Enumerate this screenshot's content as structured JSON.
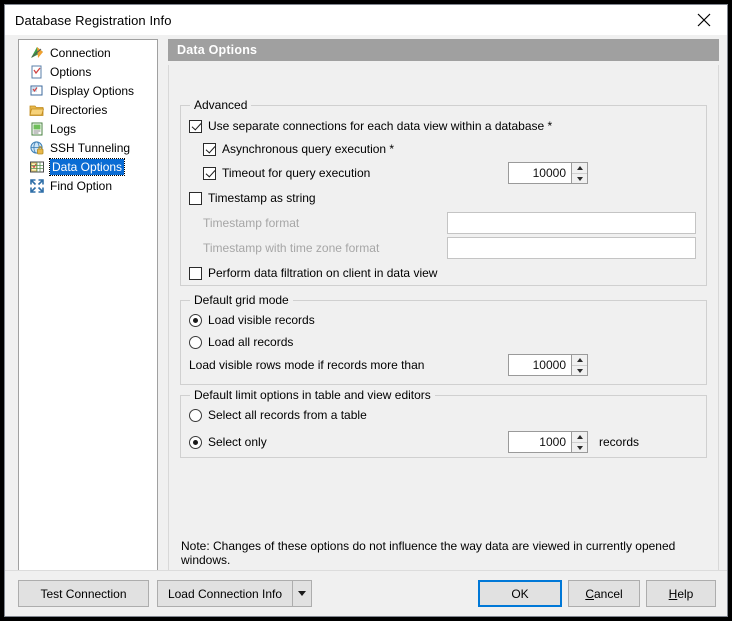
{
  "window": {
    "title": "Database Registration Info",
    "close_icon": "close-icon"
  },
  "sidebar": {
    "items": [
      {
        "label": "Connection",
        "icon": "connection-icon",
        "selected": false
      },
      {
        "label": "Options",
        "icon": "options-icon",
        "selected": false
      },
      {
        "label": "Display Options",
        "icon": "display-options-icon",
        "selected": false
      },
      {
        "label": "Directories",
        "icon": "directories-icon",
        "selected": false
      },
      {
        "label": "Logs",
        "icon": "logs-icon",
        "selected": false
      },
      {
        "label": "SSH Tunneling",
        "icon": "ssh-tunneling-icon",
        "selected": false
      },
      {
        "label": "Data Options",
        "icon": "data-options-icon",
        "selected": true
      },
      {
        "label": "Find Option",
        "icon": "find-option-icon",
        "selected": false
      }
    ]
  },
  "pane": {
    "header": "Data Options",
    "note": "Note: Changes of these options do not influence the way data are viewed in currently opened windows."
  },
  "advanced": {
    "title": "Advanced",
    "use_separate_connections": {
      "label": "Use separate connections for each data view within a database *",
      "checked": true
    },
    "async_query_execution": {
      "label": "Asynchronous query execution *",
      "checked": true
    },
    "timeout_for_query_execution": {
      "label": "Timeout for query execution",
      "checked": true,
      "value": "10000"
    },
    "timestamp_as_string": {
      "label": "Timestamp as string",
      "checked": false
    },
    "timestamp_format": {
      "label": "Timestamp format",
      "value": "",
      "placeholder": "",
      "disabled": true
    },
    "timestamp_tz_format": {
      "label": "Timestamp with time zone format",
      "value": "",
      "placeholder": "",
      "disabled": true
    },
    "perform_data_filtration": {
      "label": "Perform data filtration on client in data view",
      "checked": false
    }
  },
  "grid_mode": {
    "title": "Default grid mode",
    "load_visible_records": {
      "label": "Load visible records",
      "selected": true
    },
    "load_all_records": {
      "label": "Load all records",
      "selected": false
    },
    "threshold": {
      "label": "Load visible rows mode if records more than",
      "value": "10000"
    }
  },
  "limit_options": {
    "title": "Default limit options in table and view editors",
    "select_all": {
      "label": "Select all records from a table",
      "selected": false
    },
    "select_only": {
      "label": "Select only",
      "selected": true,
      "value": "1000",
      "suffix": "records"
    }
  },
  "footer": {
    "test_connection": "Test Connection",
    "load_connection_info": "Load Connection Info",
    "dropdown_icon": "chevron-down-icon",
    "ok": "OK",
    "cancel": "Cancel",
    "help": "Help"
  },
  "colors": {
    "accent": "#0078d7",
    "selection": "#0a6cd4",
    "header_bg": "#a0a0a0",
    "window_bg": "#f0f0f0"
  }
}
